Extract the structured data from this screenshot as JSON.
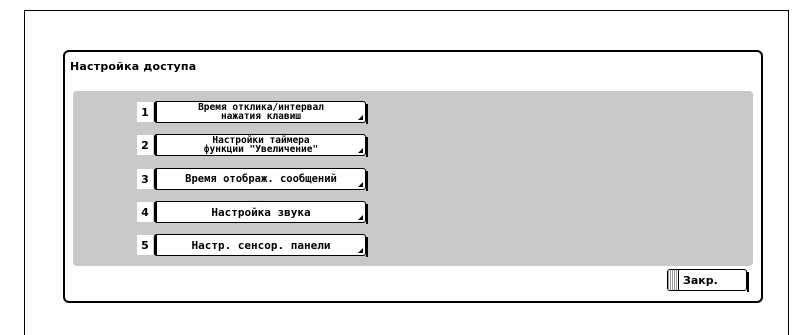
{
  "dialog": {
    "title": "Настройка доступа",
    "close_label": "Закр."
  },
  "menu": {
    "items": [
      {
        "number": "1",
        "label": "Время отклика/интервал\nнажатия клавиш"
      },
      {
        "number": "2",
        "label": "Настройки таймера\nфункции \"Увеличение\""
      },
      {
        "number": "3",
        "label": "Время отображ. сообщений"
      },
      {
        "number": "4",
        "label": "Настройка звука"
      },
      {
        "number": "5",
        "label": "Настр. сенсор. панели"
      }
    ]
  }
}
